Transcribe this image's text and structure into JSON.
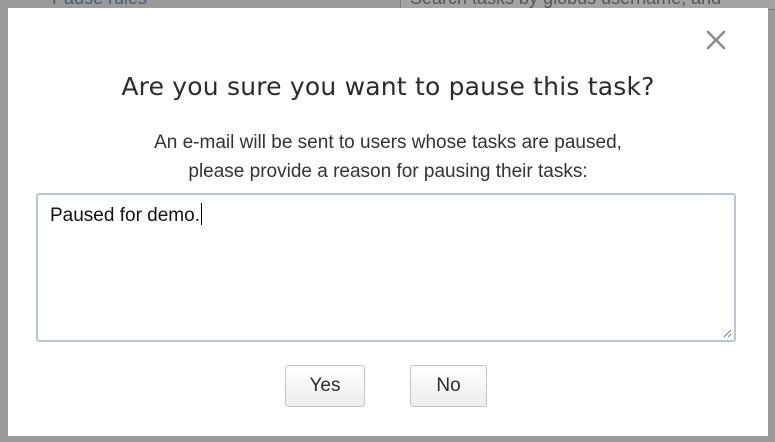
{
  "background": {
    "fragment_top": "Pause rules",
    "fragment_search": "Search tasks by globus username, and"
  },
  "dialog": {
    "title": "Are you sure you want to pause this task?",
    "message_line1": "An e-mail will be sent to users whose tasks are paused,",
    "message_line2": "please provide a reason for pausing their tasks:",
    "reason_value": "Paused for demo.",
    "yes_label": "Yes",
    "no_label": "No",
    "close_icon": "close-icon"
  }
}
